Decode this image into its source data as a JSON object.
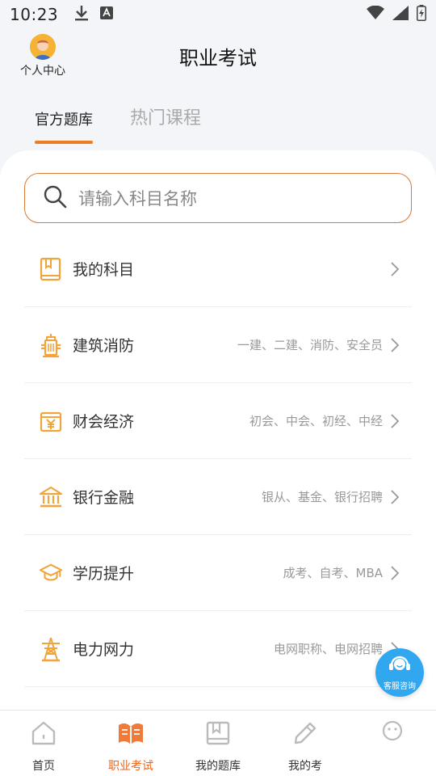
{
  "status_bar": {
    "time": "10:23"
  },
  "header": {
    "avatar_label": "个人中心",
    "title": "职业考试"
  },
  "tabs": [
    {
      "label": "官方题库",
      "active": true
    },
    {
      "label": "热门课程",
      "active": false
    }
  ],
  "search": {
    "placeholder": "请输入科目名称"
  },
  "categories": [
    {
      "label": "我的科目",
      "sub": "",
      "icon": "book-icon"
    },
    {
      "label": "建筑消防",
      "sub": "一建、二建、消防、安全员",
      "icon": "fire-hydrant-icon"
    },
    {
      "label": "财会经济",
      "sub": "初会、中会、初经、中经",
      "icon": "yuan-icon"
    },
    {
      "label": "银行金融",
      "sub": "银从、基金、银行招聘",
      "icon": "bank-icon"
    },
    {
      "label": "学历提升",
      "sub": "成考、自考、MBA",
      "icon": "graduation-cap-icon"
    },
    {
      "label": "电力网力",
      "sub": "电网职称、电网招聘",
      "icon": "power-tower-icon"
    }
  ],
  "service_button": {
    "label": "客服咨询"
  },
  "bottom_nav": [
    {
      "label": "首页",
      "icon": "home-icon",
      "active": false
    },
    {
      "label": "职业考试",
      "icon": "exam-book-icon",
      "active": true
    },
    {
      "label": "我的题库",
      "icon": "question-bank-icon",
      "active": false
    },
    {
      "label": "我的考",
      "icon": "pencil-icon",
      "active": false
    },
    {
      "label": "",
      "icon": "smiley-icon",
      "active": false
    }
  ],
  "colors": {
    "accent": "#ef7d20",
    "icon_orange": "#f0a43a",
    "service_blue": "#31a7f0"
  }
}
